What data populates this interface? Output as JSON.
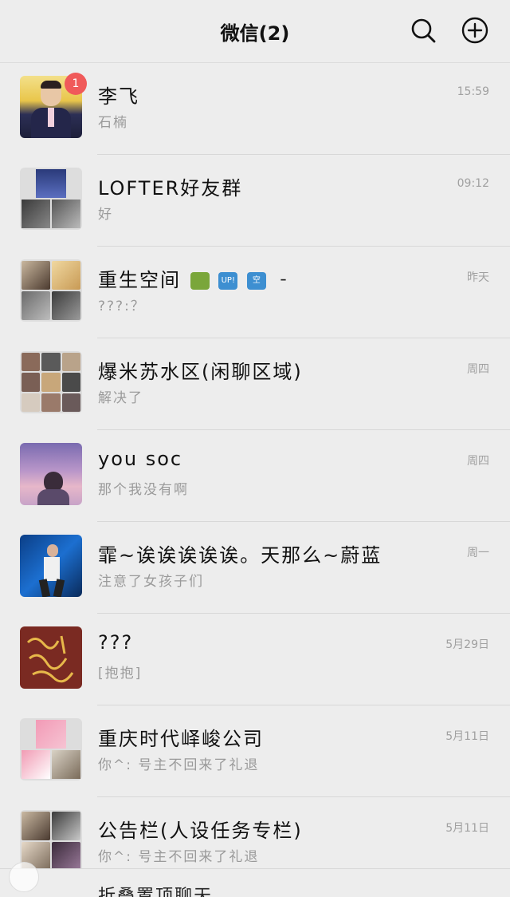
{
  "header": {
    "title": "微信(2)",
    "search_icon": "search-icon",
    "add_icon": "plus-circle-icon"
  },
  "chats": [
    {
      "name": "李飞",
      "preview": "石楠",
      "time": "15:59",
      "badge": "1"
    },
    {
      "name": "LOFTER好友群",
      "preview": "好",
      "time": "09:12"
    },
    {
      "name": "重生空间",
      "name_suffix": "UP! 空 ━",
      "preview": "???:？",
      "time": "昨天"
    },
    {
      "name": "爆米苏水区(闲聊区域)",
      "preview": "解决了",
      "time": "周四"
    },
    {
      "name": "you soc",
      "preview": "那个我没有啊",
      "time": "周四"
    },
    {
      "name": "霏~诶诶诶诶诶。天那么~蔚蓝",
      "preview": "注意了女孩子们",
      "time": "周一"
    },
    {
      "name": "???",
      "preview": "[抱抱]",
      "time": "5月29日"
    },
    {
      "name": "重庆时代峄峻公司",
      "preview": "你^: 号主不回来了礼退",
      "time": "5月11日"
    },
    {
      "name": "公告栏(人设任务专栏)",
      "preview": "你^: 号主不回来了礼退",
      "time": "5月11日"
    }
  ],
  "bottom": {
    "partial_text": "折叠置顶聊天"
  },
  "colors": {
    "background": "#ededed",
    "badge": "#f05a5a",
    "muted_text": "#9a9a9a"
  }
}
